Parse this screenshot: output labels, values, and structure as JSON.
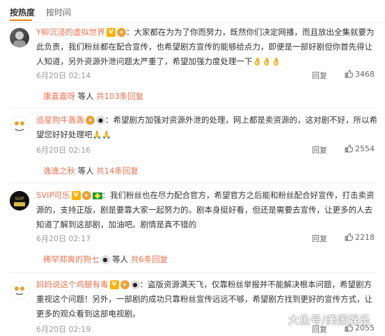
{
  "sort": {
    "hot": "按热度",
    "time": "按时间"
  },
  "comments": [
    {
      "user": "Y柳沉浸的虚拟世界",
      "text": "：大家都在为为了你而努力，既然你们决定网播，而且放出全集就要为此负责，我们粉丝都在配合宣传，也希望剧方宣传的能够给点力，即便是一部好剧但你首先得让人知道，另外资源外泄问题太严重了，希望加强力度处理一下",
      "emoji": "👌👌👌",
      "time": "6月20日 02:14",
      "reply": "回复",
      "likes": "3468",
      "sub_user": "康嘉嘉呀",
      "sub_text": " 等人 ",
      "sub_more": "共103条回复"
    },
    {
      "user": "追星狗牛轰轰",
      "text": "：希望剧方加强对资源外泄的处理，网上都是卖资源的，这对剧不好，所以希望您好好处理吧",
      "emoji": "🙏🙏",
      "time": "6月20日 02:16",
      "reply": "回复",
      "likes": "2554",
      "sub_user": "逸逸之秋",
      "sub_text": " 等人 ",
      "sub_more": "共14条回复"
    },
    {
      "user": "SVIP可乐",
      "text": "：我们粉丝也在尽力配合官方，希望官方之后能和粉丝配合好宣传，打击卖资源的，支持正版，剧是要靠大家一起努力的。剧本身挺好看，但还是需要去宣传，让更多的人去知道了解到这部剧，加油吧。剧情是真不错的",
      "emoji": "",
      "time": "6月20日 02:17",
      "reply": "回复",
      "likes": "2218",
      "sub_user": "稀罕郑爽的狗七",
      "sub_text": " 等人 ",
      "sub_more": "共6条回复"
    },
    {
      "user": "妈妈说这个鸡腿有毒",
      "text": "：盗版资源满天飞，仅靠粉丝举报并不能解决根本问题，希望剧方重视这个问题！另外，一部剧的成功只靠粉丝宣传远远不够，希望剧方找到更好的宣传方式，让更多的观众看到这部电视剧。",
      "emoji": "",
      "time": "6月20日 02:19",
      "reply": "回复",
      "likes": "2055"
    }
  ],
  "watermark": "大鱼号/美国娱乐",
  "colors": {
    "accent": "#ff8200",
    "username": "#eb7350"
  }
}
